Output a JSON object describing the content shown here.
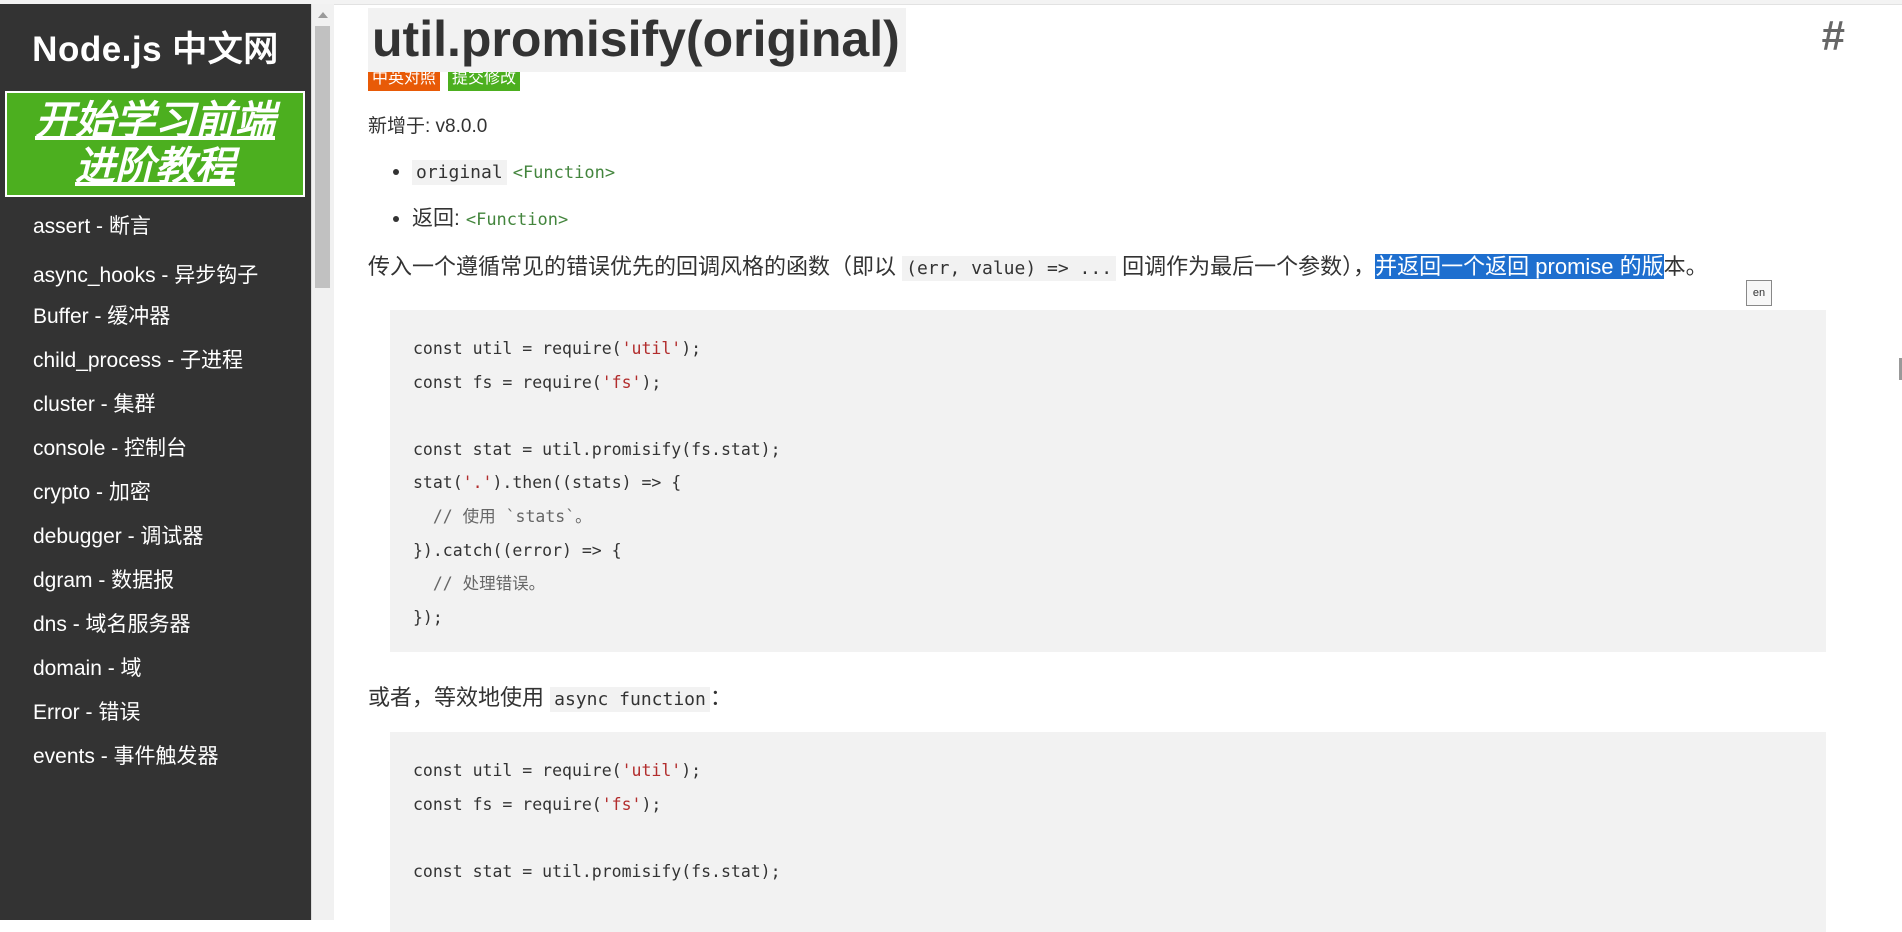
{
  "sidebar": {
    "brand": "Node.js 中文网",
    "promo_line1": "开始学习前端",
    "promo_line2": "进阶教程",
    "items": [
      {
        "label": "assert - 断言"
      },
      {
        "label": "async_hooks - 异步钩子"
      },
      {
        "label": "Buffer - 缓冲器"
      },
      {
        "label": "child_process - 子进程"
      },
      {
        "label": "cluster - 集群"
      },
      {
        "label": "console - 控制台"
      },
      {
        "label": "crypto - 加密"
      },
      {
        "label": "debugger - 调试器"
      },
      {
        "label": "dgram - 数据报"
      },
      {
        "label": "dns - 域名服务器"
      },
      {
        "label": "domain - 域"
      },
      {
        "label": "Error - 错误"
      },
      {
        "label": "events - 事件触发器"
      }
    ]
  },
  "main": {
    "title": "util.promisify(original)",
    "anchor": "#",
    "badges": {
      "compare": "中英对照",
      "edit": "提交修改"
    },
    "added_in": "新增于: v8.0.0",
    "params": [
      {
        "name": "original",
        "type": "<Function>"
      },
      {
        "name": "返回:",
        "type": "<Function>"
      }
    ],
    "desc_before": "传入一个遵循常见的错误优先的回调风格的函数（即以 ",
    "desc_code": "(err, value) => ...",
    "desc_middle": " 回调作为最后一个参数），",
    "desc_selected": "并返回一个返回 promise 的版",
    "desc_after": "本。",
    "translate_icon": "en",
    "code1": [
      {
        "kw": "const util = require(",
        "str": "'util'",
        "end": ");"
      },
      {
        "kw": "const fs = require(",
        "str": "'fs'",
        "end": ");"
      },
      {
        "kw": "",
        "str": "",
        "end": ""
      },
      {
        "kw": "const stat = util.promisify(fs.stat);",
        "str": "",
        "end": ""
      },
      {
        "kw": "stat(",
        "str": "'.'",
        "end": ").then((stats) => {"
      },
      {
        "cmt": "  // 使用 `stats`。"
      },
      {
        "kw": "}).catch((error) => {",
        "str": "",
        "end": ""
      },
      {
        "cmt": "  // 处理错误。"
      },
      {
        "kw": "});",
        "str": "",
        "end": ""
      }
    ],
    "alt_before": "或者，等效地使用 ",
    "alt_code": "async function",
    "alt_after": "：",
    "code2": [
      {
        "kw": "const util = require(",
        "str": "'util'",
        "end": ");"
      },
      {
        "kw": "const fs = require(",
        "str": "'fs'",
        "end": ");"
      },
      {
        "kw": "",
        "str": "",
        "end": ""
      },
      {
        "kw": "const stat = util.promisify(fs.stat);",
        "str": "",
        "end": ""
      }
    ]
  }
}
